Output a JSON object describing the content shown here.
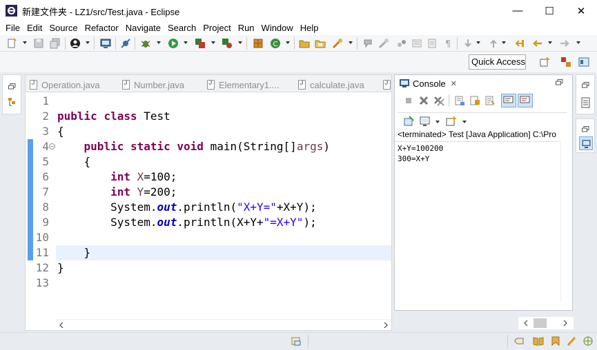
{
  "window": {
    "title": "新建文件夹 - LZ1/src/Test.java - Eclipse",
    "minimize": "—",
    "maximize": "☐",
    "close": "✕"
  },
  "menu": [
    "File",
    "Edit",
    "Source",
    "Refactor",
    "Navigate",
    "Search",
    "Project",
    "Run",
    "Window",
    "Help"
  ],
  "quick_access": "Quick Access",
  "editor": {
    "tabs": [
      "Operation.java",
      "Number.java",
      "Elementary1....",
      "calculate.java"
    ],
    "line_numbers": [
      "1",
      "2",
      "3",
      "4",
      "5",
      "6",
      "7",
      "8",
      "9",
      "10",
      "11",
      "12",
      "13"
    ],
    "code": {
      "l2_kw1": "public",
      "l2_kw2": "class",
      "l2_name": "Test",
      "l3": "{",
      "l4_kw1": "public",
      "l4_kw2": "static",
      "l4_kw3": "void",
      "l4_sig": "main(String[]",
      "l4_arg": "args",
      "l4_close": ")",
      "l5": "{",
      "l6_kw": "int",
      "l6_var": "X",
      "l6_rest": "=100;",
      "l7_kw": "int",
      "l7_var": "Y",
      "l7_rest": "=200;",
      "l8_a": "System.",
      "l8_out": "out",
      "l8_b": ".println(",
      "l8_str": "\"X+Y=\"",
      "l8_c": "+X+Y);",
      "l9_a": "System.",
      "l9_out": "out",
      "l9_b": ".println(X+Y+",
      "l9_str": "\"=X+Y\"",
      "l9_c": ");",
      "l11": "}",
      "l12": "}"
    }
  },
  "console": {
    "tab_label": "Console",
    "status": "<terminated> Test [Java Application] C:\\Pro",
    "output": [
      "X+Y=100200",
      "300=X+Y"
    ]
  }
}
